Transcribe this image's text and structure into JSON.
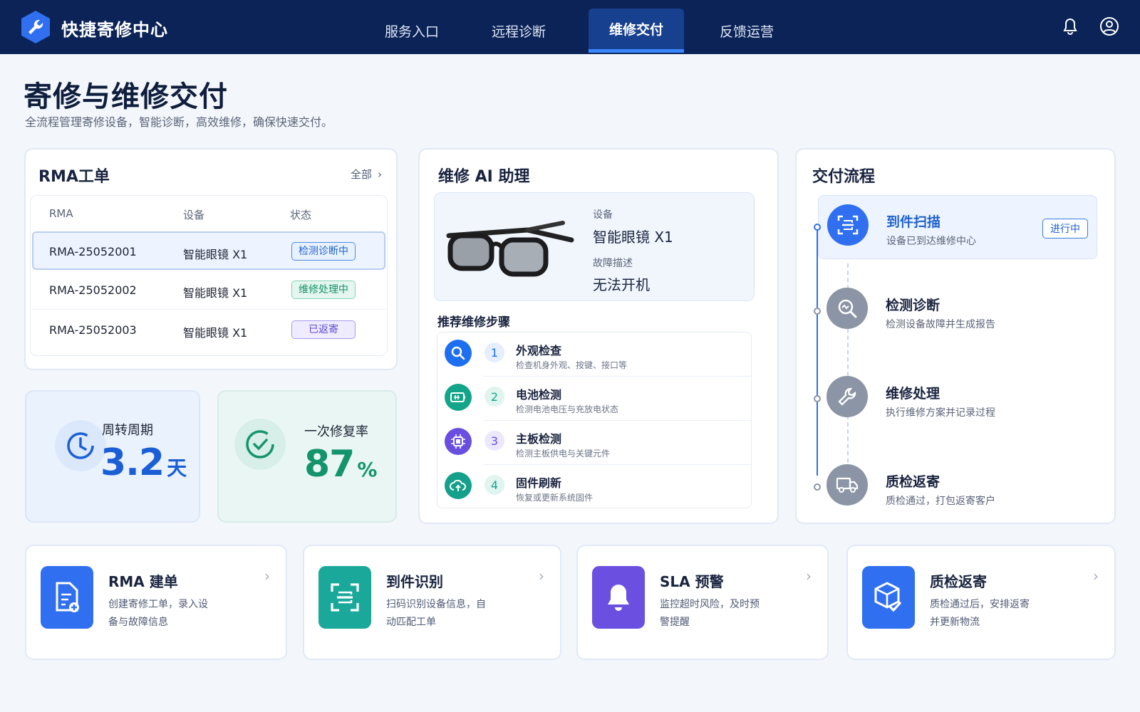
{
  "header": {
    "brand": "快捷寄修中心",
    "nav": [
      {
        "label": "服务入口",
        "active": false
      },
      {
        "label": "远程诊断",
        "active": false
      },
      {
        "label": "维修交付",
        "active": true
      },
      {
        "label": "反馈运营",
        "active": false
      }
    ],
    "icons": [
      "bell-icon",
      "user-icon"
    ]
  },
  "page": {
    "title": "寄修与维修交付",
    "subtitle": "全流程管理寄修设备，智能诊断，高效维修，确保快速交付。"
  },
  "rma": {
    "title": "RMA工单",
    "all_label": "全部",
    "columns": [
      "RMA",
      "设备",
      "状态"
    ],
    "rows": [
      {
        "id": "RMA-25052001",
        "device": "智能眼镜 X1",
        "status": "检测诊断中",
        "status_color": "blue",
        "selected": true
      },
      {
        "id": "RMA-25052002",
        "device": "智能眼镜 X1",
        "status": "维修处理中",
        "status_color": "green",
        "selected": false
      },
      {
        "id": "RMA-25052003",
        "device": "智能眼镜 X1",
        "status": "已返寄",
        "status_color": "purple",
        "selected": false
      }
    ]
  },
  "stats": {
    "turnaround": {
      "label": "周转周期",
      "value": "3.2",
      "unit": "天",
      "color": "#1a5fd6"
    },
    "first_fix": {
      "label": "一次修复率",
      "value": "87",
      "unit": "%",
      "color": "#13946d"
    }
  },
  "assistant": {
    "title": "维修 AI 助理",
    "device_label": "设备",
    "device_value": "智能眼镜 X1",
    "fault_label": "故障描述",
    "fault_value": "无法开机",
    "steps_title": "推荐维修步骤",
    "steps": [
      {
        "num": "1",
        "title": "外观检查",
        "desc": "检查机身外观、按键、接口等",
        "icon": "search-icon",
        "color": "#1e6ff0"
      },
      {
        "num": "2",
        "title": "电池检测",
        "desc": "检测电池电压与充放电状态",
        "icon": "battery-icon",
        "color": "#12a58a"
      },
      {
        "num": "3",
        "title": "主板检测",
        "desc": "检测主板供电与关键元件",
        "icon": "chip-icon",
        "color": "#6a4ee0"
      },
      {
        "num": "4",
        "title": "固件刷新",
        "desc": "恢复或更新系统固件",
        "icon": "cloud-upload-icon",
        "color": "#14a08a"
      }
    ]
  },
  "flow": {
    "title": "交付流程",
    "items": [
      {
        "title": "到件扫描",
        "desc": "设备已到达维修中心",
        "icon": "scan-icon",
        "active": true,
        "status": "进行中"
      },
      {
        "title": "检测诊断",
        "desc": "检测设备故障并生成报告",
        "icon": "magnifier-icon",
        "active": false
      },
      {
        "title": "维修处理",
        "desc": "执行维修方案并记录过程",
        "icon": "wrench-icon",
        "active": false
      },
      {
        "title": "质检返寄",
        "desc": "质检通过，打包返寄客户",
        "icon": "truck-icon",
        "active": false
      }
    ]
  },
  "quick": [
    {
      "title": "RMA 建单",
      "desc": "创建寄修工单，录入设备与故障信息",
      "icon": "document-add-icon",
      "color": "#2f6ff0"
    },
    {
      "title": "到件识别",
      "desc": "扫码识别设备信息，自动匹配工单",
      "icon": "scan-icon",
      "color": "#1aa89a"
    },
    {
      "title": "SLA 预警",
      "desc": "监控超时风险，及时预警提醒",
      "icon": "bell-icon",
      "color": "#6b4fe0"
    },
    {
      "title": "质检返寄",
      "desc": "质检通过后，安排返寄并更新物流",
      "icon": "package-check-icon",
      "color": "#2f6ff0"
    }
  ]
}
